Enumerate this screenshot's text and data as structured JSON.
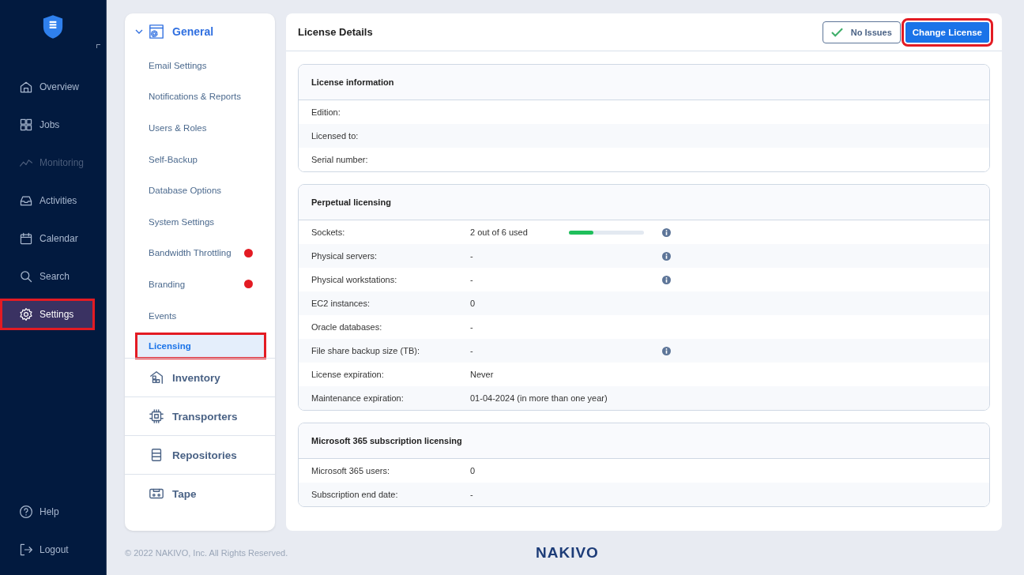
{
  "sidebar": {
    "items": [
      {
        "label": "Overview",
        "kind": "home",
        "selected": false,
        "disabled": false,
        "highlighted": false
      },
      {
        "label": "Jobs",
        "kind": "grid",
        "selected": false,
        "disabled": false,
        "highlighted": false
      },
      {
        "label": "Monitoring",
        "kind": "chart",
        "selected": false,
        "disabled": true,
        "highlighted": false
      },
      {
        "label": "Activities",
        "kind": "inbox",
        "selected": false,
        "disabled": false,
        "highlighted": false
      },
      {
        "label": "Calendar",
        "kind": "calendar",
        "selected": false,
        "disabled": false,
        "highlighted": false
      },
      {
        "label": "Search",
        "kind": "search",
        "selected": false,
        "disabled": false,
        "highlighted": false
      },
      {
        "label": "Settings",
        "kind": "gear",
        "selected": true,
        "disabled": false,
        "highlighted": true
      }
    ],
    "bottom_items": [
      {
        "label": "Help",
        "kind": "help"
      },
      {
        "label": "Logout",
        "kind": "logout"
      }
    ]
  },
  "settings_nav": {
    "group": {
      "label": "General",
      "expanded": true,
      "items": [
        {
          "label": "Email Settings",
          "selected": false,
          "warning": false,
          "highlighted": false
        },
        {
          "label": "Notifications & Reports",
          "selected": false,
          "warning": false,
          "highlighted": false
        },
        {
          "label": "Users & Roles",
          "selected": false,
          "warning": false,
          "highlighted": false
        },
        {
          "label": "Self-Backup",
          "selected": false,
          "warning": false,
          "highlighted": false
        },
        {
          "label": "Database Options",
          "selected": false,
          "warning": false,
          "highlighted": false
        },
        {
          "label": "System Settings",
          "selected": false,
          "warning": false,
          "highlighted": false
        },
        {
          "label": "Bandwidth Throttling",
          "selected": false,
          "warning": true,
          "highlighted": false
        },
        {
          "label": "Branding",
          "selected": false,
          "warning": true,
          "highlighted": false
        },
        {
          "label": "Events",
          "selected": false,
          "warning": false,
          "highlighted": false
        },
        {
          "label": "Licensing",
          "selected": true,
          "warning": false,
          "highlighted": true
        }
      ]
    },
    "sections": [
      {
        "label": "Inventory",
        "kind": "inventory"
      },
      {
        "label": "Transporters",
        "kind": "chip"
      },
      {
        "label": "Repositories",
        "kind": "storage"
      },
      {
        "label": "Tape",
        "kind": "tape"
      }
    ]
  },
  "content": {
    "title": "License Details",
    "status_button": "No Issues",
    "change_button": {
      "label": "Change License",
      "highlighted": true
    },
    "sections": [
      {
        "title": "License information",
        "rows": [
          {
            "label": "Edition:",
            "kind": "plain",
            "info": false
          },
          {
            "label": "Licensed to:",
            "kind": "plain",
            "info": false
          },
          {
            "label": "Serial number:",
            "kind": "plain",
            "info": false
          }
        ]
      },
      {
        "title": "Perpetual licensing",
        "rows": [
          {
            "label": "Sockets:",
            "value": "2 out of 6 used",
            "kind": "meter",
            "level": 0.33,
            "info": true
          },
          {
            "label": "Physical servers:",
            "value": "-",
            "kind": "plain",
            "info": true
          },
          {
            "label": "Physical workstations:",
            "value": "-",
            "kind": "plain",
            "info": true
          },
          {
            "label": "EC2 instances:",
            "value": "0",
            "kind": "plain",
            "info": false
          },
          {
            "label": "Oracle databases:",
            "value": "-",
            "kind": "plain",
            "info": false
          },
          {
            "label": "File share backup size (TB):",
            "value": "-",
            "kind": "plain",
            "info": true
          },
          {
            "label": "License expiration:",
            "value": "Never",
            "kind": "plain",
            "info": false
          },
          {
            "label": "Maintenance expiration:",
            "value": "01-04-2024 (in more than one year)",
            "kind": "plain",
            "info": false
          }
        ]
      },
      {
        "title": "Microsoft 365 subscription licensing",
        "rows": [
          {
            "label": "Microsoft 365 users:",
            "value": "0",
            "kind": "plain",
            "info": false
          },
          {
            "label": "Subscription end date:",
            "value": "-",
            "kind": "plain",
            "info": false
          }
        ]
      }
    ]
  },
  "footer": {
    "copyright": "© 2022 NAKIVO, Inc. All Rights Reserved.",
    "logo": "NAKIVO"
  }
}
